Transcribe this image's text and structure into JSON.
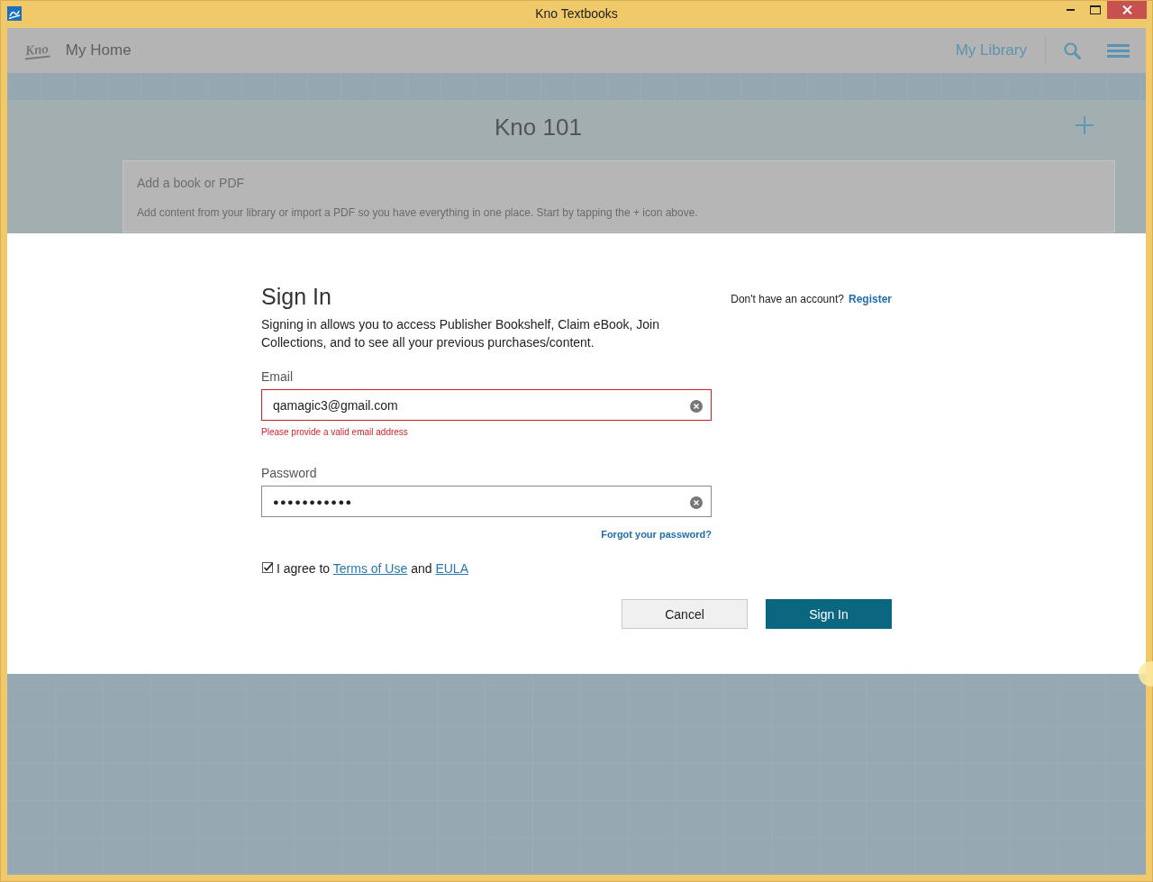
{
  "window": {
    "title": "Kno Textbooks"
  },
  "header": {
    "logo": "Kno",
    "title": "My Home",
    "nav_link": "My Library"
  },
  "collection": {
    "title": "Kno 101",
    "card": {
      "title": "Add a book or PDF",
      "text": "Add content from your library or import a PDF so you have everything in one place. Start by tapping the + icon above."
    }
  },
  "sign_in": {
    "title": "Sign In",
    "register_prompt": "Don't have an account?",
    "register_link": "Register",
    "description": "Signing in allows you to access Publisher Bookshelf, Claim eBook, Join Collections, and to see all your previous purchases/content.",
    "fields": [
      {
        "label": "Email",
        "kind": "email",
        "value": "qamagic3@gmail.com",
        "invalid": true,
        "error": "Please provide a valid email address"
      },
      {
        "label": "Password",
        "kind": "password",
        "value": "●●●●●●●●●●●",
        "invalid": false
      }
    ],
    "forgot_link": "Forgot your password?",
    "agreement": {
      "checked": true,
      "parts": [
        {
          "kind": "text",
          "text": "I agree to"
        },
        {
          "kind": "link",
          "text": "Terms of Use"
        },
        {
          "kind": "text",
          "text": "and"
        },
        {
          "kind": "link",
          "text": "EULA"
        }
      ]
    },
    "buttons": [
      {
        "label": "Cancel",
        "kind": "secondary"
      },
      {
        "label": "Sign In",
        "kind": "primary"
      }
    ]
  }
}
